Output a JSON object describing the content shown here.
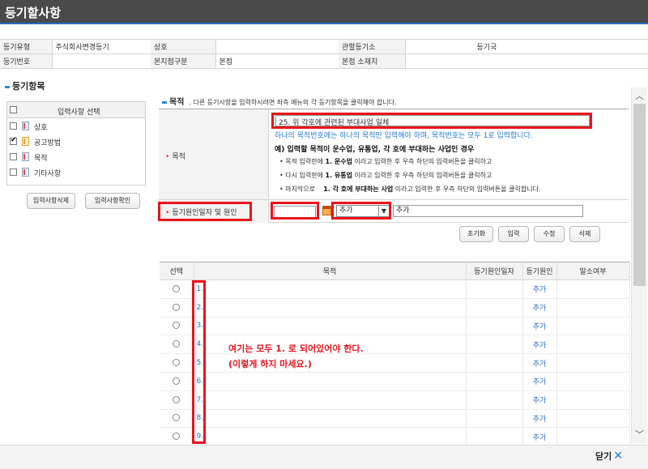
{
  "window": {
    "title": "등기할사항",
    "close_label": "닫기"
  },
  "info": {
    "row1": {
      "type_label": "등기유형",
      "type_value": "주식회사변경등기",
      "name_label": "상호",
      "name_value": "",
      "office_label": "관할등기소",
      "office_value": "등기국"
    },
    "row2": {
      "no_label": "등기번호",
      "no_value": "",
      "branch_label": "본지점구분",
      "branch_value": "본점",
      "addr_label": "본점 소재지",
      "addr_value": ""
    }
  },
  "left": {
    "section_title": "등기항목",
    "header_label": "입력사항 선택",
    "items": [
      {
        "label": "상호",
        "checked": false
      },
      {
        "label": "공고방법",
        "checked": true
      },
      {
        "label": "목적",
        "checked": false
      },
      {
        "label": "기타사항",
        "checked": false
      }
    ],
    "delete_btn": "입력사항삭제",
    "confirm_btn": "입력사항확인"
  },
  "purpose": {
    "title": "목적",
    "note": ". 다른 등기사항을 입력하시려면 좌측 메뉴의 각 등기항목을 클릭해야 합니다.",
    "field_label": "목적",
    "text_value": "25. 위 각호에 관련된 부대사업 일체",
    "hint1": "하나의 목적번호에는 하나의 목적만 입력해야 하며, 목적번호는 모두 1로 입력합니다.",
    "hint2": "예) 입력할 목적이 운수업, 유통업, 각 호에 부대하는 사업인 경우",
    "bullets": [
      {
        "pre": "• 목적 입력란에 ",
        "bold": "1. 운수업",
        "post": " 이라고 입력한 후 우측 하단의 입력버튼을 클릭하고"
      },
      {
        "pre": "• 다시 입력란에 ",
        "bold": "1. 유통업",
        "post": " 이라고 입력한 후 우측 하단의 입력버튼을 클릭하고"
      },
      {
        "pre": "• 마지막으로    ",
        "bold": "1. 각 호에 부대하는 사업",
        "post": " 이라고 입력한 후 우측 하단의 입력버튼을 클릭합니다."
      }
    ],
    "cause_label": "등기원인일자 및 원인",
    "date_value": "",
    "select_value": "추가",
    "cause_value": "추가"
  },
  "actions": {
    "reset": "초기화",
    "input": "입력",
    "edit": "수정",
    "delete": "삭제"
  },
  "grid": {
    "headers": [
      "선택",
      "목적",
      "등기원인일자",
      "등기원인",
      "말소여부"
    ],
    "rows": [
      {
        "no": "1.",
        "cause": "추가"
      },
      {
        "no": "2.",
        "cause": "추가"
      },
      {
        "no": "3.",
        "cause": "추가"
      },
      {
        "no": "4.",
        "cause": "추가"
      },
      {
        "no": "5.",
        "cause": "추가"
      },
      {
        "no": "6.",
        "cause": "추가"
      },
      {
        "no": "7.",
        "cause": "추가"
      },
      {
        "no": "8.",
        "cause": "추가"
      },
      {
        "no": "9.",
        "cause": "추가"
      }
    ]
  },
  "annotation": {
    "line1": "여기는 모두 1. 로 되어있어야 한다.",
    "line2": "(이렇게 하지 마세요.)",
    "color": "#e8141c"
  },
  "colors": {
    "accent": "#2b8ad8",
    "title_bg": "#4a4a4a",
    "highlight": "#e8141c",
    "link": "#2a6fc0"
  }
}
